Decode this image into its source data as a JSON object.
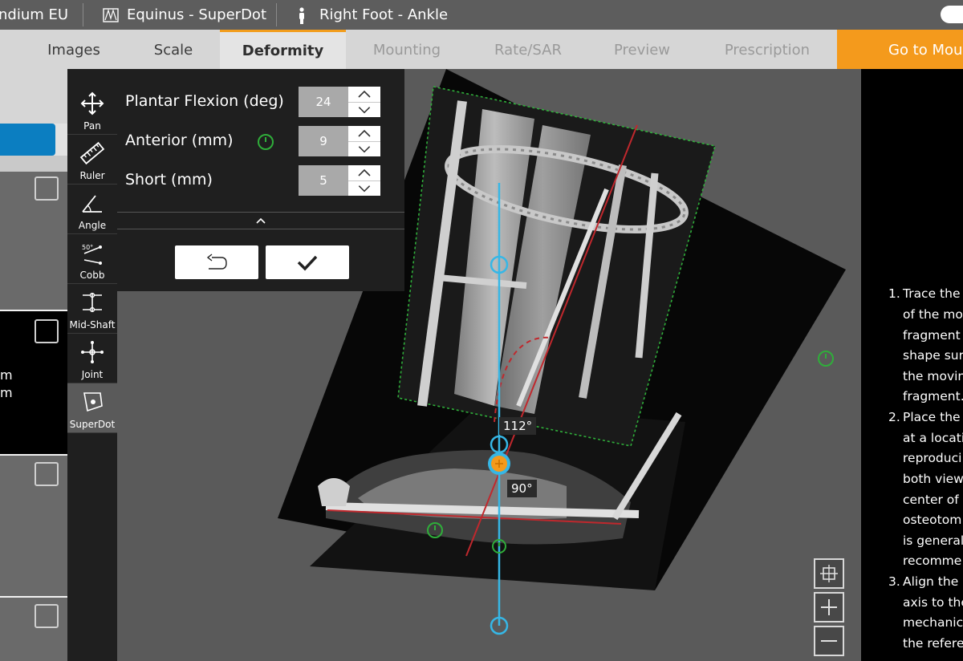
{
  "titlebar": {
    "workspace": "ndium EU",
    "case_name": "Equinus - SuperDot",
    "limb": "Right Foot - Ankle"
  },
  "tabs": [
    {
      "label": "Images",
      "state": "normal"
    },
    {
      "label": "Scale",
      "state": "normal"
    },
    {
      "label": "Deformity",
      "state": "active"
    },
    {
      "label": "Mounting",
      "state": "disabled"
    },
    {
      "label": "Rate/SAR",
      "state": "disabled"
    },
    {
      "label": "Preview",
      "state": "disabled"
    },
    {
      "label": "Prescription",
      "state": "disabled"
    }
  ],
  "go_button": {
    "label": "Go to Moun"
  },
  "left_panel": {
    "lines": [
      "m",
      "m"
    ]
  },
  "tools": [
    {
      "label": "Pan",
      "icon": "pan-icon"
    },
    {
      "label": "Ruler",
      "icon": "ruler-icon"
    },
    {
      "label": "Angle",
      "icon": "angle-icon"
    },
    {
      "label": "Cobb",
      "icon": "cobb-icon"
    },
    {
      "label": "Mid-Shaft",
      "icon": "mid-shaft-icon"
    },
    {
      "label": "Joint",
      "icon": "joint-icon"
    },
    {
      "label": "SuperDot",
      "icon": "superdot-icon",
      "active": true
    }
  ],
  "params": [
    {
      "label": "Plantar Flexion (deg)",
      "value": "24"
    },
    {
      "label": "Anterior (mm)",
      "value": "9"
    },
    {
      "label": "Short (mm)",
      "value": "5"
    }
  ],
  "canvas": {
    "angle_labels": [
      "112°",
      "90°"
    ]
  },
  "instructions": {
    "lines": [
      {
        "num": "1.",
        "text": "Trace the"
      },
      {
        "num": "",
        "text": "of the mov"
      },
      {
        "num": "",
        "text": "fragment"
      },
      {
        "num": "",
        "text": "shape sur"
      },
      {
        "num": "",
        "text": "the movin"
      },
      {
        "num": "",
        "text": "fragment."
      },
      {
        "num": "2.",
        "text": "Place the"
      },
      {
        "num": "",
        "text": "at a locati"
      },
      {
        "num": "",
        "text": "reproduci"
      },
      {
        "num": "",
        "text": "both view"
      },
      {
        "num": "",
        "text": "center of t"
      },
      {
        "num": "",
        "text": "osteotom"
      },
      {
        "num": "",
        "text": "is general"
      },
      {
        "num": "",
        "text": "recomme"
      },
      {
        "num": "3.",
        "text": "Align the S"
      },
      {
        "num": "",
        "text": "axis to the"
      },
      {
        "num": "",
        "text": "mechanic"
      },
      {
        "num": "",
        "text": "the refere"
      }
    ]
  },
  "colors": {
    "accent_orange": "#f49a1c",
    "guide_blue": "#36b7e6",
    "axis_red": "#c0282d",
    "handle_green": "#2fae3a"
  }
}
